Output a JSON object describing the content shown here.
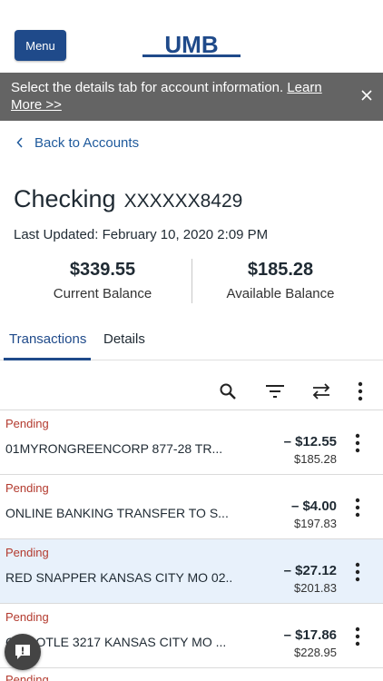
{
  "header": {
    "menu_label": "Menu",
    "logo_text": "UMB",
    "logo_color": "#1f4a8a"
  },
  "banner": {
    "message": "Select the details tab for account information. ",
    "link_text": "Learn More >>",
    "close_icon": "close-icon"
  },
  "nav": {
    "back_label": "Back to Accounts"
  },
  "account": {
    "name": "Checking",
    "number": "XXXXXX8429",
    "last_updated": "Last Updated: February 10, 2020 2:09 PM",
    "current_balance": "$339.55",
    "current_balance_label": "Current Balance",
    "available_balance": "$185.28",
    "available_balance_label": "Available Balance"
  },
  "tabs": [
    {
      "label": "Transactions",
      "active": true
    },
    {
      "label": "Details",
      "active": false
    }
  ],
  "toolbar": {
    "icons": [
      "search-icon",
      "filter-icon",
      "sort-icon",
      "more-icon"
    ]
  },
  "transactions": [
    {
      "status": "Pending",
      "description": "01MYRONGREENCORP 877-28 TR...",
      "amount": "– $12.55",
      "balance": "$185.28"
    },
    {
      "status": "Pending",
      "description": "ONLINE BANKING TRANSFER TO S...",
      "amount": "– $4.00",
      "balance": "$197.83"
    },
    {
      "status": "Pending",
      "description": "RED SNAPPER KANSAS CITY MO 02...",
      "amount": "– $27.12",
      "balance": "$201.83"
    },
    {
      "status": "Pending",
      "description": "CHIPOTLE 3217 KANSAS CITY MO ...",
      "amount": "– $17.86",
      "balance": "$228.95"
    },
    {
      "status": "Pending",
      "description": "",
      "amount": "",
      "balance": ""
    }
  ],
  "colors": {
    "brand": "#1f4a8a",
    "pending": "#b33a2e",
    "banner_bg": "#646464",
    "highlight_row": "#e8f1fb"
  }
}
